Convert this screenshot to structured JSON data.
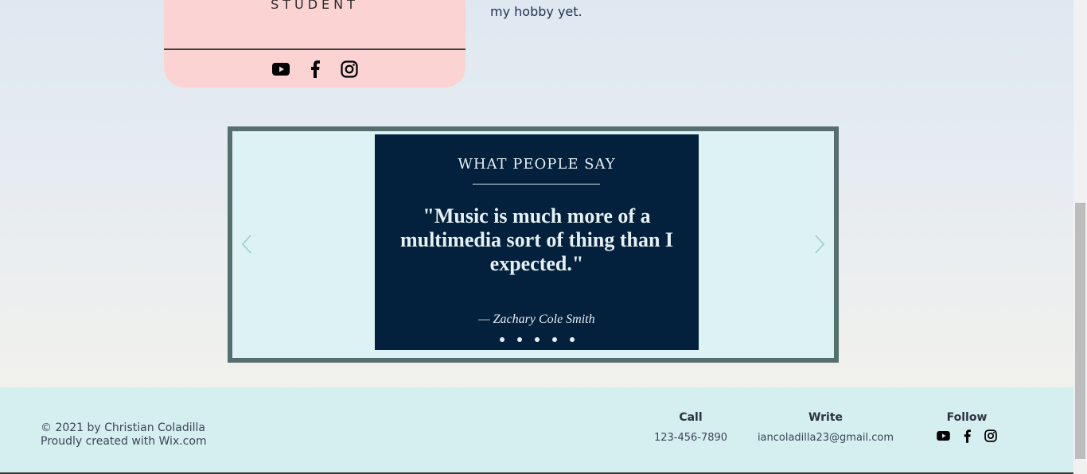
{
  "profile": {
    "role": "STUDENT",
    "social": [
      "youtube-icon",
      "facebook-icon",
      "instagram-icon"
    ]
  },
  "bio": {
    "tail_text": "my hobby yet."
  },
  "testimonials": {
    "heading": "WHAT PEOPLE SAY",
    "quote": "\"Music is much more of a multimedia sort of thing than I expected.\"",
    "author": "— Zachary Cole Smith",
    "slide_count": 5,
    "prev_icon": "chevron-left-icon",
    "next_icon": "chevron-right-icon"
  },
  "footer": {
    "copyright_line1": "© 2021 by Christian Coladilla",
    "copyright_line2": "Proudly created with Wix.com",
    "call_label": "Call",
    "call_value": "123-456-7890",
    "write_label": "Write",
    "write_value": "iancoladilla23@gmail.com",
    "follow_label": "Follow"
  },
  "colors": {
    "card_pink": "#fbd3d3",
    "quote_panel": "#03203d",
    "frame_border": "#556e6e",
    "footer_bg": "#d5eef0"
  }
}
